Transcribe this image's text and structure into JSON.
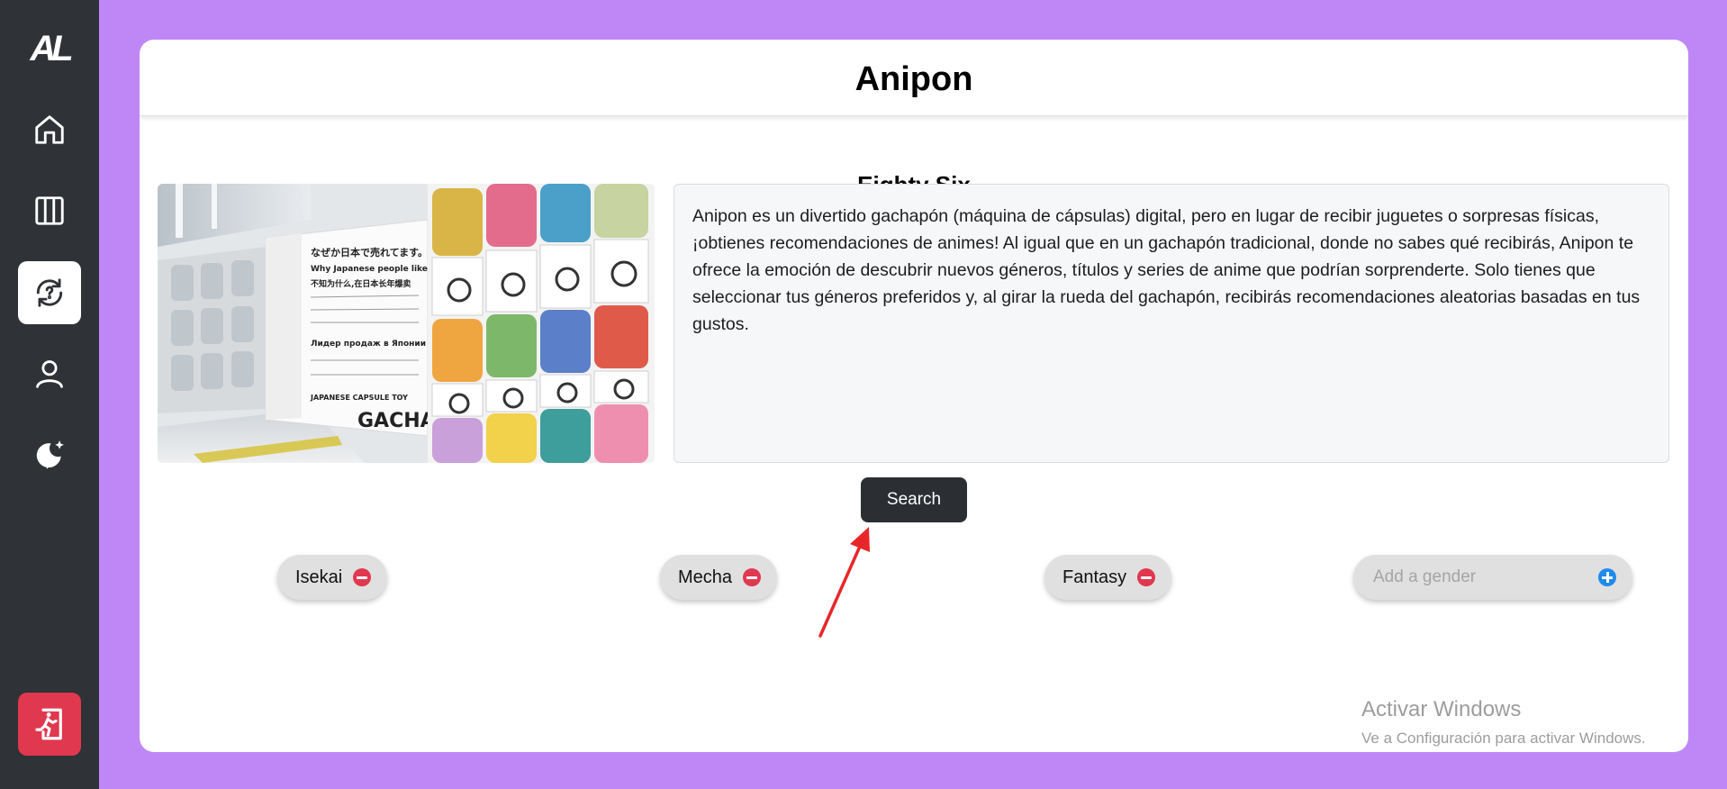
{
  "sidebar": {
    "logo_text": "AL",
    "items": [
      {
        "icon": "home-icon",
        "active": false
      },
      {
        "icon": "library-icon",
        "active": false
      },
      {
        "icon": "refresh-icon",
        "active": true
      },
      {
        "icon": "user-icon",
        "active": false
      },
      {
        "icon": "sparkle-icon",
        "active": false
      }
    ],
    "logout_icon": "logout-icon"
  },
  "header": {
    "title": "Anipon"
  },
  "main": {
    "subtitle": "Eighty Six",
    "image": {
      "sign_text_1": "なぜか日本で売れてます。",
      "sign_text_2": "Why Japanese people like this!",
      "sign_text_3": "不知为什么,在日本长年爆卖",
      "sign_text_4": "Лидер продаж в Японии",
      "sign_text_5": "JAPANESE CAPSULE TOY",
      "sign_text_6": "GACHA"
    },
    "description": "Anipon es un divertido gachapón (máquina de cápsulas) digital, pero en lugar de recibir juguetes o sorpresas físicas, ¡obtienes recomendaciones de animes! Al igual que en un gachapón tradicional, donde no sabes qué recibirás, Anipon te ofrece la emoción de descubrir nuevos géneros, títulos y series de anime que podrían sorprenderte. Solo tienes que seleccionar tus géneros preferidos y, al girar la rueda del gachapón, recibirás recomendaciones aleatorias basadas en tus gustos.",
    "search_button": "Search",
    "genres": [
      {
        "label": "Isekai"
      },
      {
        "label": "Mecha"
      },
      {
        "label": "Fantasy"
      }
    ],
    "add_gender": {
      "placeholder": "Add a gender",
      "value": ""
    }
  },
  "watermark": {
    "line1": "Activar Windows",
    "line2": "Ve a Configuración para activar Windows."
  },
  "colors": {
    "background": "#bf87f6",
    "sidebar": "#2f3236",
    "danger": "#e0384f",
    "accent": "#1f8bf0",
    "annotation_arrow": "#e8262a"
  }
}
